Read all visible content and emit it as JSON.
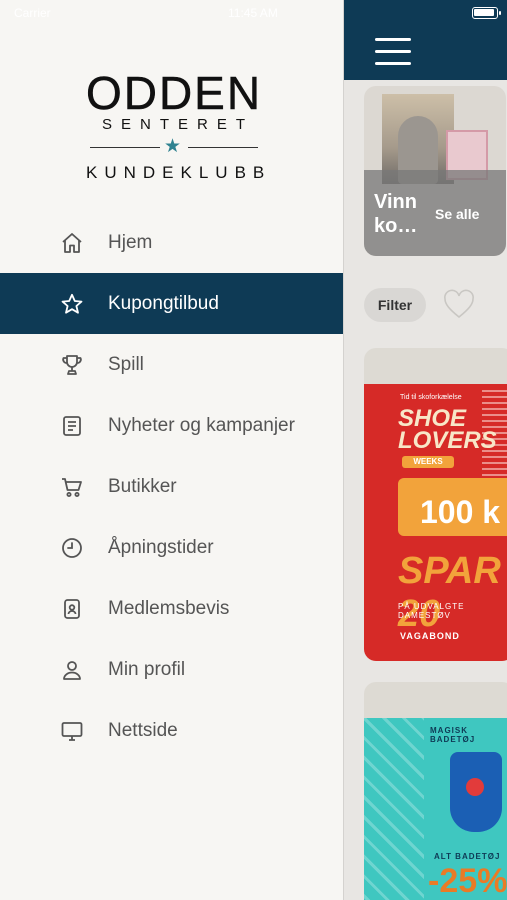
{
  "status_bar": {
    "left": "Carrier",
    "time": "11:45 AM"
  },
  "logo": {
    "word": "ODDEN",
    "sub": "SENTERET",
    "club": "KUNDEKLUBB",
    "star_color": "#2f8290"
  },
  "menu": {
    "items": [
      {
        "label": "Hjem",
        "icon": "home-icon",
        "active": false
      },
      {
        "label": "Kupongtilbud",
        "icon": "star-icon",
        "active": true
      },
      {
        "label": "Spill",
        "icon": "trophy-icon",
        "active": false
      },
      {
        "label": "Nyheter og kampanjer",
        "icon": "news-icon",
        "active": false
      },
      {
        "label": "Butikker",
        "icon": "cart-icon",
        "active": false
      },
      {
        "label": "Åpningstider",
        "icon": "clock-icon",
        "active": false
      },
      {
        "label": "Medlemsbevis",
        "icon": "member-card-icon",
        "active": false
      },
      {
        "label": "Min profil",
        "icon": "user-icon",
        "active": false
      },
      {
        "label": "Nettside",
        "icon": "monitor-icon",
        "active": false
      }
    ]
  },
  "colors": {
    "primary": "#0e3a55",
    "background": "#f7f6f3",
    "text": "#555555"
  },
  "main": {
    "promo": {
      "title": "Vinn ko…",
      "see_all": "Se alle"
    },
    "filter_label": "Filter",
    "offers": [
      {
        "tid": "Tid til skoforkælelse",
        "shoe": "SHOE LOVERS",
        "weeks": "WEEKS",
        "value": "100 k",
        "spar": "SPAR 20",
        "utvalgte": "PÅ UDVALGTE DAMESTØV",
        "brand": "VAGABOND"
      },
      {
        "headline": "MAGISK BADETØJ",
        "alt": "ALT BADETØJ",
        "pct": "-25%"
      }
    ]
  }
}
